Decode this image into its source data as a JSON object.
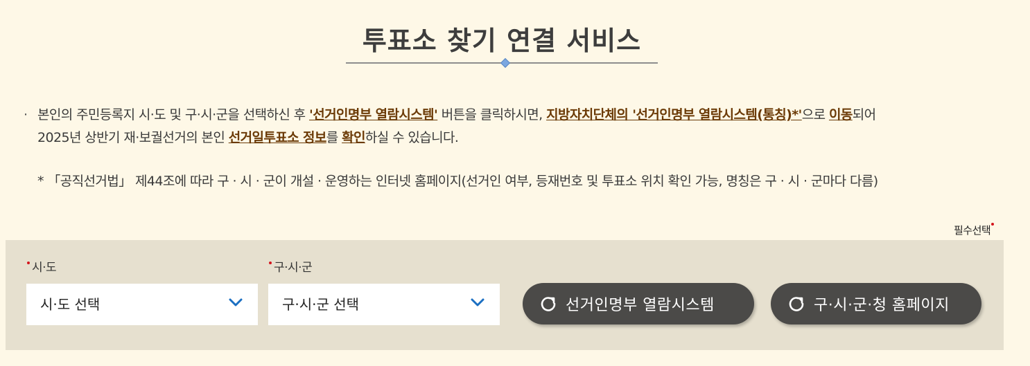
{
  "header": {
    "title": "투표소 찾기 연결 서비스"
  },
  "notice": {
    "bullet": "·",
    "line1": {
      "t1": "본인의 주민등록지 시·도 및 구·시·군을 선택하신 후 ",
      "h1": "'선거인명부 열람시스템'",
      "t2": " 버튼을 클릭하시면, ",
      "h2": "지방자치단체의 '선거인명부 열람시스템(통칭)*'",
      "t3": "으로 ",
      "h3": "이동",
      "t4": "되어"
    },
    "line2": {
      "t1": "2025년 상반기 재·보궐선거의 본인 ",
      "h1": "선거일투표소 정보",
      "t2": "를 ",
      "h2": "확인",
      "t3": "하실 수 있습니다."
    },
    "footnote": "* 「공직선거법」 제44조에 따라 구 · 시 · 군이 개설 · 운영하는 인터넷 홈페이지(선거인 여부, 등재번호 및 투표소 위치 확인 가능, 명칭은 구 · 시 · 군마다 다름)"
  },
  "required_note": "필수선택",
  "search": {
    "sido": {
      "label": "시·도",
      "selected": "시·도 선택"
    },
    "gugun": {
      "label": "구·시·군",
      "selected": "구·시·군 선택"
    },
    "buttons": {
      "voter_registry": "선거인명부 열람시스템",
      "homepage": "구·시·군·청 홈페이지"
    }
  },
  "colors": {
    "page_background": "#fef8e7",
    "panel_background": "#e6e0cf",
    "highlight_text": "#6b3a06",
    "button_background": "#4b4a48",
    "required_dot": "#d4141c",
    "chevron": "#1b6fc2"
  },
  "icons": {
    "select_arrow": "chevron-down-icon",
    "button_icon": "refresh-icon",
    "title_ornament": "diamond-icon"
  }
}
